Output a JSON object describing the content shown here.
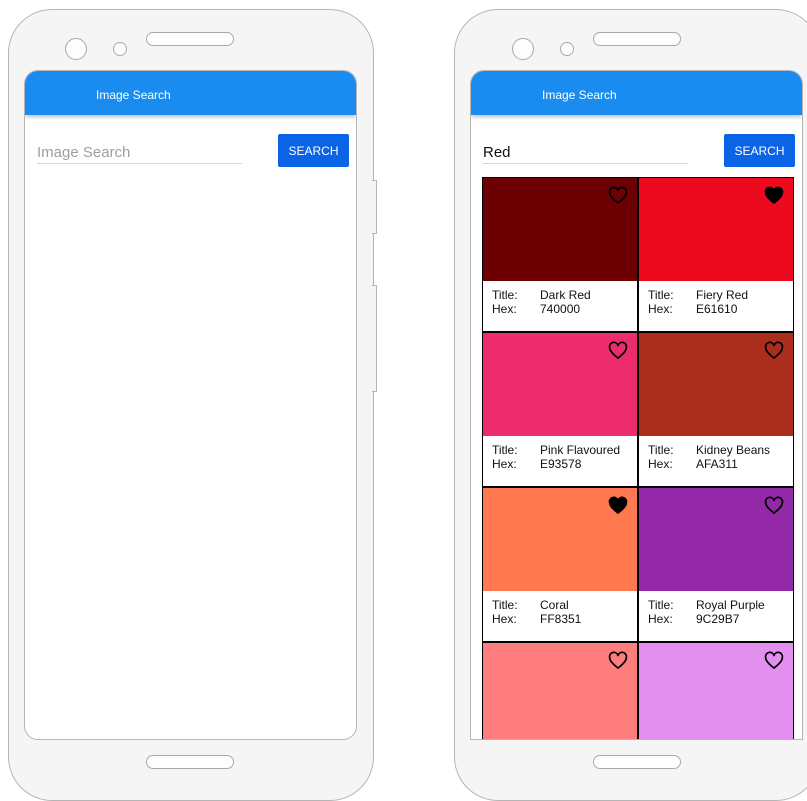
{
  "left_screen": {
    "appbar": {
      "title": "Image Search"
    },
    "search": {
      "value": "",
      "placeholder": "Image Search"
    },
    "button": {
      "label": "SEARCH"
    }
  },
  "right_screen": {
    "appbar": {
      "title": "Image Search"
    },
    "search": {
      "value": "Red",
      "placeholder": "Image Search"
    },
    "button": {
      "label": "SEARCH"
    },
    "labels": {
      "title": "Title:",
      "hex": "Hex:"
    },
    "colors": [
      {
        "title": "Dark Red",
        "hex": "740000",
        "swatch": "#6c0003",
        "favorite": false
      },
      {
        "title": "Fiery Red",
        "hex": "E61610",
        "swatch": "#ee0a1e",
        "favorite": true
      },
      {
        "title": "Pink Flavoured",
        "hex": "E93578",
        "swatch": "#ec2c6c",
        "favorite": false
      },
      {
        "title": "Kidney Beans",
        "hex": "AFA311",
        "swatch": "#aa2e1b",
        "favorite": false
      },
      {
        "title": "Coral",
        "hex": "FF8351",
        "swatch": "#ff7850",
        "favorite": true
      },
      {
        "title": "Royal Purple",
        "hex": "9C29B7",
        "swatch": "#9328a8",
        "favorite": false
      },
      {
        "title": "",
        "hex": "",
        "swatch": "#ff7d7d",
        "favorite": false
      },
      {
        "title": "",
        "hex": "",
        "swatch": "#e28ff0",
        "favorite": false
      }
    ]
  },
  "icons": {
    "heart_outline": "heart-outline-icon",
    "heart_filled": "heart-filled-icon"
  }
}
